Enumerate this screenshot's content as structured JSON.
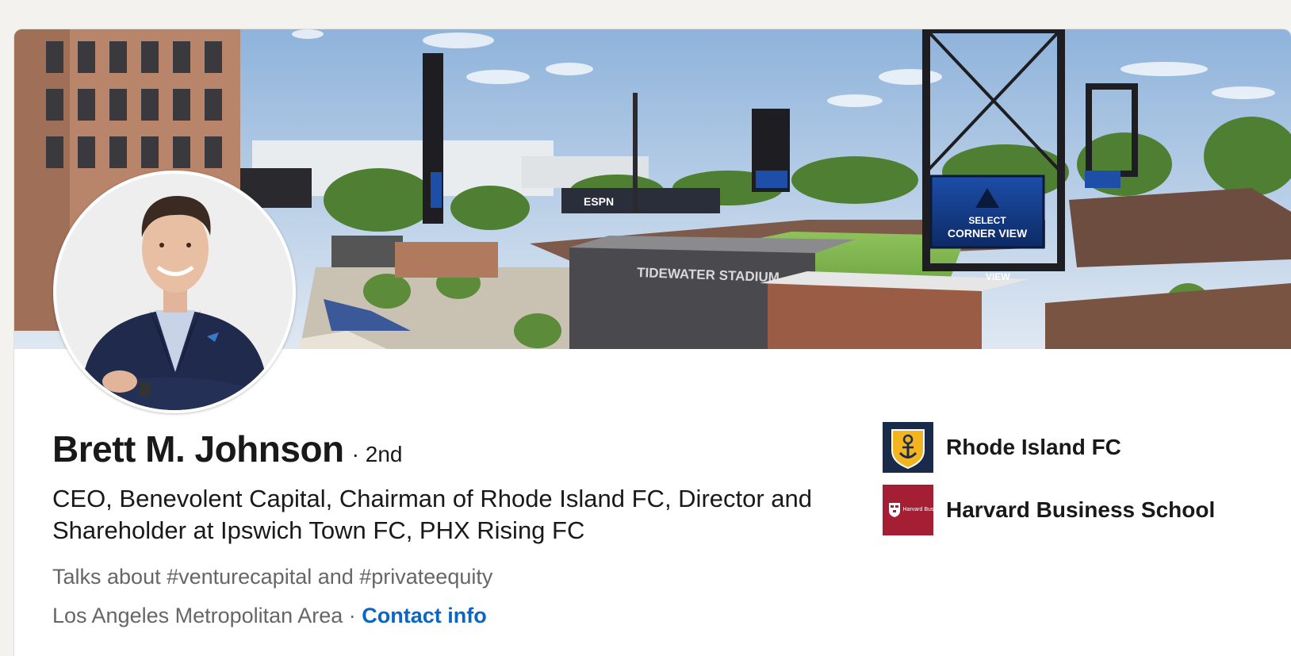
{
  "profile": {
    "name": "Brett M. Johnson",
    "degree": "· 2nd",
    "headline": "CEO, Benevolent Capital, Chairman of Rhode Island FC, Director and Shareholder at Ipswich Town FC, PHX Rising FC",
    "talks_about": "Talks about #venturecapital and #privateequity",
    "location": "Los Angeles Metropolitan Area",
    "separator": " · ",
    "contact_label": "Contact info"
  },
  "banner": {
    "stadium_sign": "TIDEWATER STADIUM",
    "scoreboard_line1": "SELECT",
    "scoreboard_line2": "CORNER VIEW",
    "sign_view": "VIEW",
    "ribbon_brand": "ESPN"
  },
  "organizations": [
    {
      "name": "Rhode Island FC",
      "logo_icon": "rhode-island-fc-crest-icon",
      "color": "#1a2b4a",
      "accent": "#f2b41f"
    },
    {
      "name": "Harvard Business School",
      "logo_icon": "harvard-business-school-shield-icon",
      "color": "#a41e34",
      "logo_text": "Harvard Business School"
    }
  ],
  "colors": {
    "link": "#0a66c2",
    "text_primary": "#191919",
    "text_secondary": "#666666",
    "page_bg": "#f3f2ef"
  }
}
